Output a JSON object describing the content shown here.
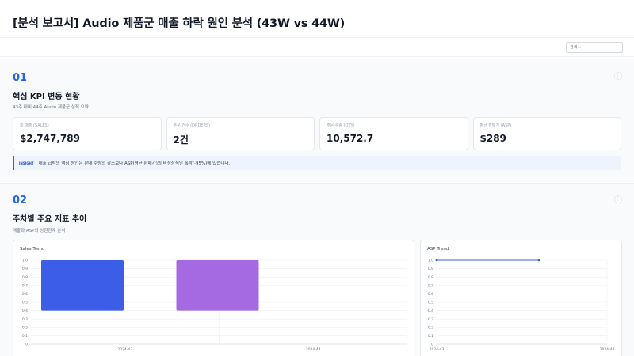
{
  "header": {
    "title": "[분석 보고서] Audio 제품군 매출 하락 원인 분석 (43W vs 44W)"
  },
  "toolbar": {
    "search_placeholder": "검색..."
  },
  "section1": {
    "number": "01",
    "title": "핵심 KPI 변동 현황",
    "subtitle": "43주 대비 44주 Audio 제품군 실적 요약",
    "kpis": [
      {
        "label": "총 매출 (SALES)",
        "value": "$2,747,789"
      },
      {
        "label": "주문 건수 (ORDERS)",
        "value": "2건"
      },
      {
        "label": "주문 수량 (QTY)",
        "value": "10,572.7"
      },
      {
        "label": "평균 판매가 (ASP)",
        "value": "$289"
      }
    ],
    "insight": {
      "tag": "INSIGHT",
      "text": "매출 급락의 핵심 원인은 판매 수량의 감소보다 ASP(평균 판매가)의 비정상적인 폭락(-95%)에 있습니다."
    }
  },
  "section2": {
    "number": "02",
    "title": "주차별 주요 지표 추이",
    "subtitle": "매출과 ASP의 상관관계 분석"
  },
  "more_label": "⋮",
  "chart_data": [
    {
      "type": "bar",
      "title": "Sales Trend",
      "categories": [
        "2024-43",
        "2024-44"
      ],
      "series": [
        {
          "values": [
            [
              0.4,
              1.0
            ],
            [
              0.4,
              1.0
            ]
          ]
        }
      ],
      "colors": [
        "#3b5de7",
        "#a56ae2"
      ],
      "ylim": [
        0,
        1.0
      ],
      "yticks": [
        "0",
        "0.1",
        "0.2",
        "0.3",
        "0.4",
        "0.5",
        "0.6",
        "0.7",
        "0.8",
        "0.9",
        "1.0"
      ],
      "grid": true
    },
    {
      "type": "line",
      "title": "ASP Trend",
      "x": [
        "2024-43",
        "2024-44"
      ],
      "series": [
        {
          "values": [
            1.0,
            1.0
          ]
        }
      ],
      "color": "#3b5de7",
      "ylim": [
        0,
        1.0
      ],
      "yticks": [
        "0",
        "0.1",
        "0.2",
        "0.3",
        "0.4",
        "0.5",
        "0.6",
        "0.7",
        "0.8",
        "0.9",
        "1.0"
      ],
      "xticks": [
        "2024-43",
        "2024-44"
      ],
      "grid": true
    }
  ]
}
